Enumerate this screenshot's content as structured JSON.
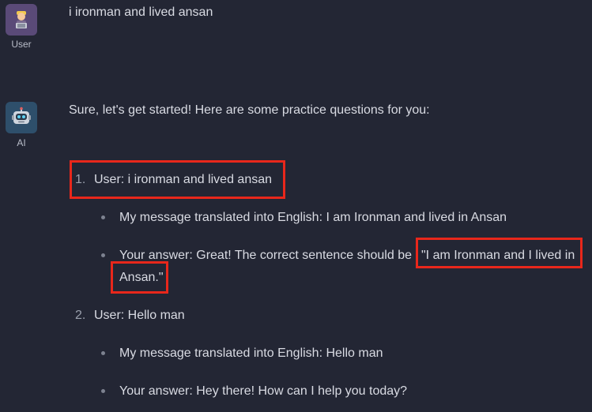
{
  "user_message": {
    "sender_label": "User",
    "avatar_icon": "person-laptop-icon",
    "text": "i ironman and lived ansan"
  },
  "ai_message": {
    "sender_label": "AI",
    "avatar_icon": "robot-icon",
    "intro": "Sure, let's get started! Here are some practice questions for you:",
    "items": [
      {
        "number": "1.",
        "text": "User: i ironman and lived ansan",
        "bullets": [
          {
            "text": "My message translated into English: I am Ironman and lived in Ansan"
          },
          {
            "prefix": "Your answer: Great! The correct sentence should be ",
            "quote_part1": "\"I am Ironman and I lived in",
            "quote_part2": "Ansan.\""
          }
        ]
      },
      {
        "number": "2.",
        "text": "User: Hello man",
        "bullets": [
          {
            "text": "My message translated into English: Hello man"
          },
          {
            "text": "Your answer: Hey there! How can I help you today?"
          }
        ]
      }
    ]
  },
  "colors": {
    "background": "#232634",
    "highlight_box": "#e8271b"
  }
}
